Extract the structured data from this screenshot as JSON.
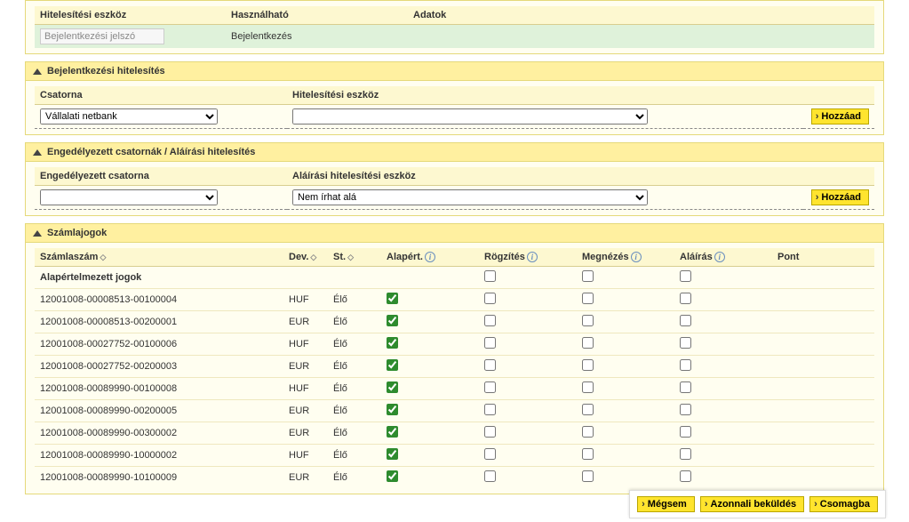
{
  "authTools": {
    "cols": {
      "eszkoz": "Hitelesítési eszköz",
      "hasznal": "Használható",
      "adatok": "Adatok"
    },
    "row": {
      "placeholder": "Bejelentkezési jelszó",
      "hasznal": "Bejelentkezés"
    }
  },
  "loginAuth": {
    "title": "Bejelentkezési hitelesítés",
    "cols": {
      "csatorna": "Csatorna",
      "eszkoz": "Hitelesítési eszköz"
    },
    "csatornaOption": "Vállalati netbank",
    "addBtn": "Hozzáad"
  },
  "chanSign": {
    "title": "Engedélyezett csatornák / Aláírási hitelesítés",
    "cols": {
      "csatorna": "Engedélyezett csatorna",
      "eszkoz": "Aláírási hitelesítési eszköz"
    },
    "eszkozOption": "Nem írhat alá",
    "addBtn": "Hozzáad"
  },
  "rights": {
    "title": "Számlajogok",
    "cols": {
      "szamla": "Számlaszám",
      "dev": "Dev.",
      "st": "St.",
      "alap": "Alapért.",
      "rogz": "Rögzítés",
      "megn": "Megnézés",
      "alair": "Aláírás",
      "pont": "Pont"
    },
    "defaultRow": "Alapértelmezett jogok",
    "rows": [
      {
        "szam": "12001008-00008513-00100004",
        "dev": "HUF",
        "st": "Élő"
      },
      {
        "szam": "12001008-00008513-00200001",
        "dev": "EUR",
        "st": "Élő"
      },
      {
        "szam": "12001008-00027752-00100006",
        "dev": "HUF",
        "st": "Élő"
      },
      {
        "szam": "12001008-00027752-00200003",
        "dev": "EUR",
        "st": "Élő"
      },
      {
        "szam": "12001008-00089990-00100008",
        "dev": "HUF",
        "st": "Élő"
      },
      {
        "szam": "12001008-00089990-00200005",
        "dev": "EUR",
        "st": "Élő"
      },
      {
        "szam": "12001008-00089990-00300002",
        "dev": "EUR",
        "st": "Élő"
      },
      {
        "szam": "12001008-00089990-10000002",
        "dev": "HUF",
        "st": "Élő"
      },
      {
        "szam": "12001008-00089990-10100009",
        "dev": "EUR",
        "st": "Élő"
      }
    ]
  },
  "footer": {
    "megsem": "Mégsem",
    "azonnali": "Azonnali beküldés",
    "csomagba": "Csomagba"
  }
}
